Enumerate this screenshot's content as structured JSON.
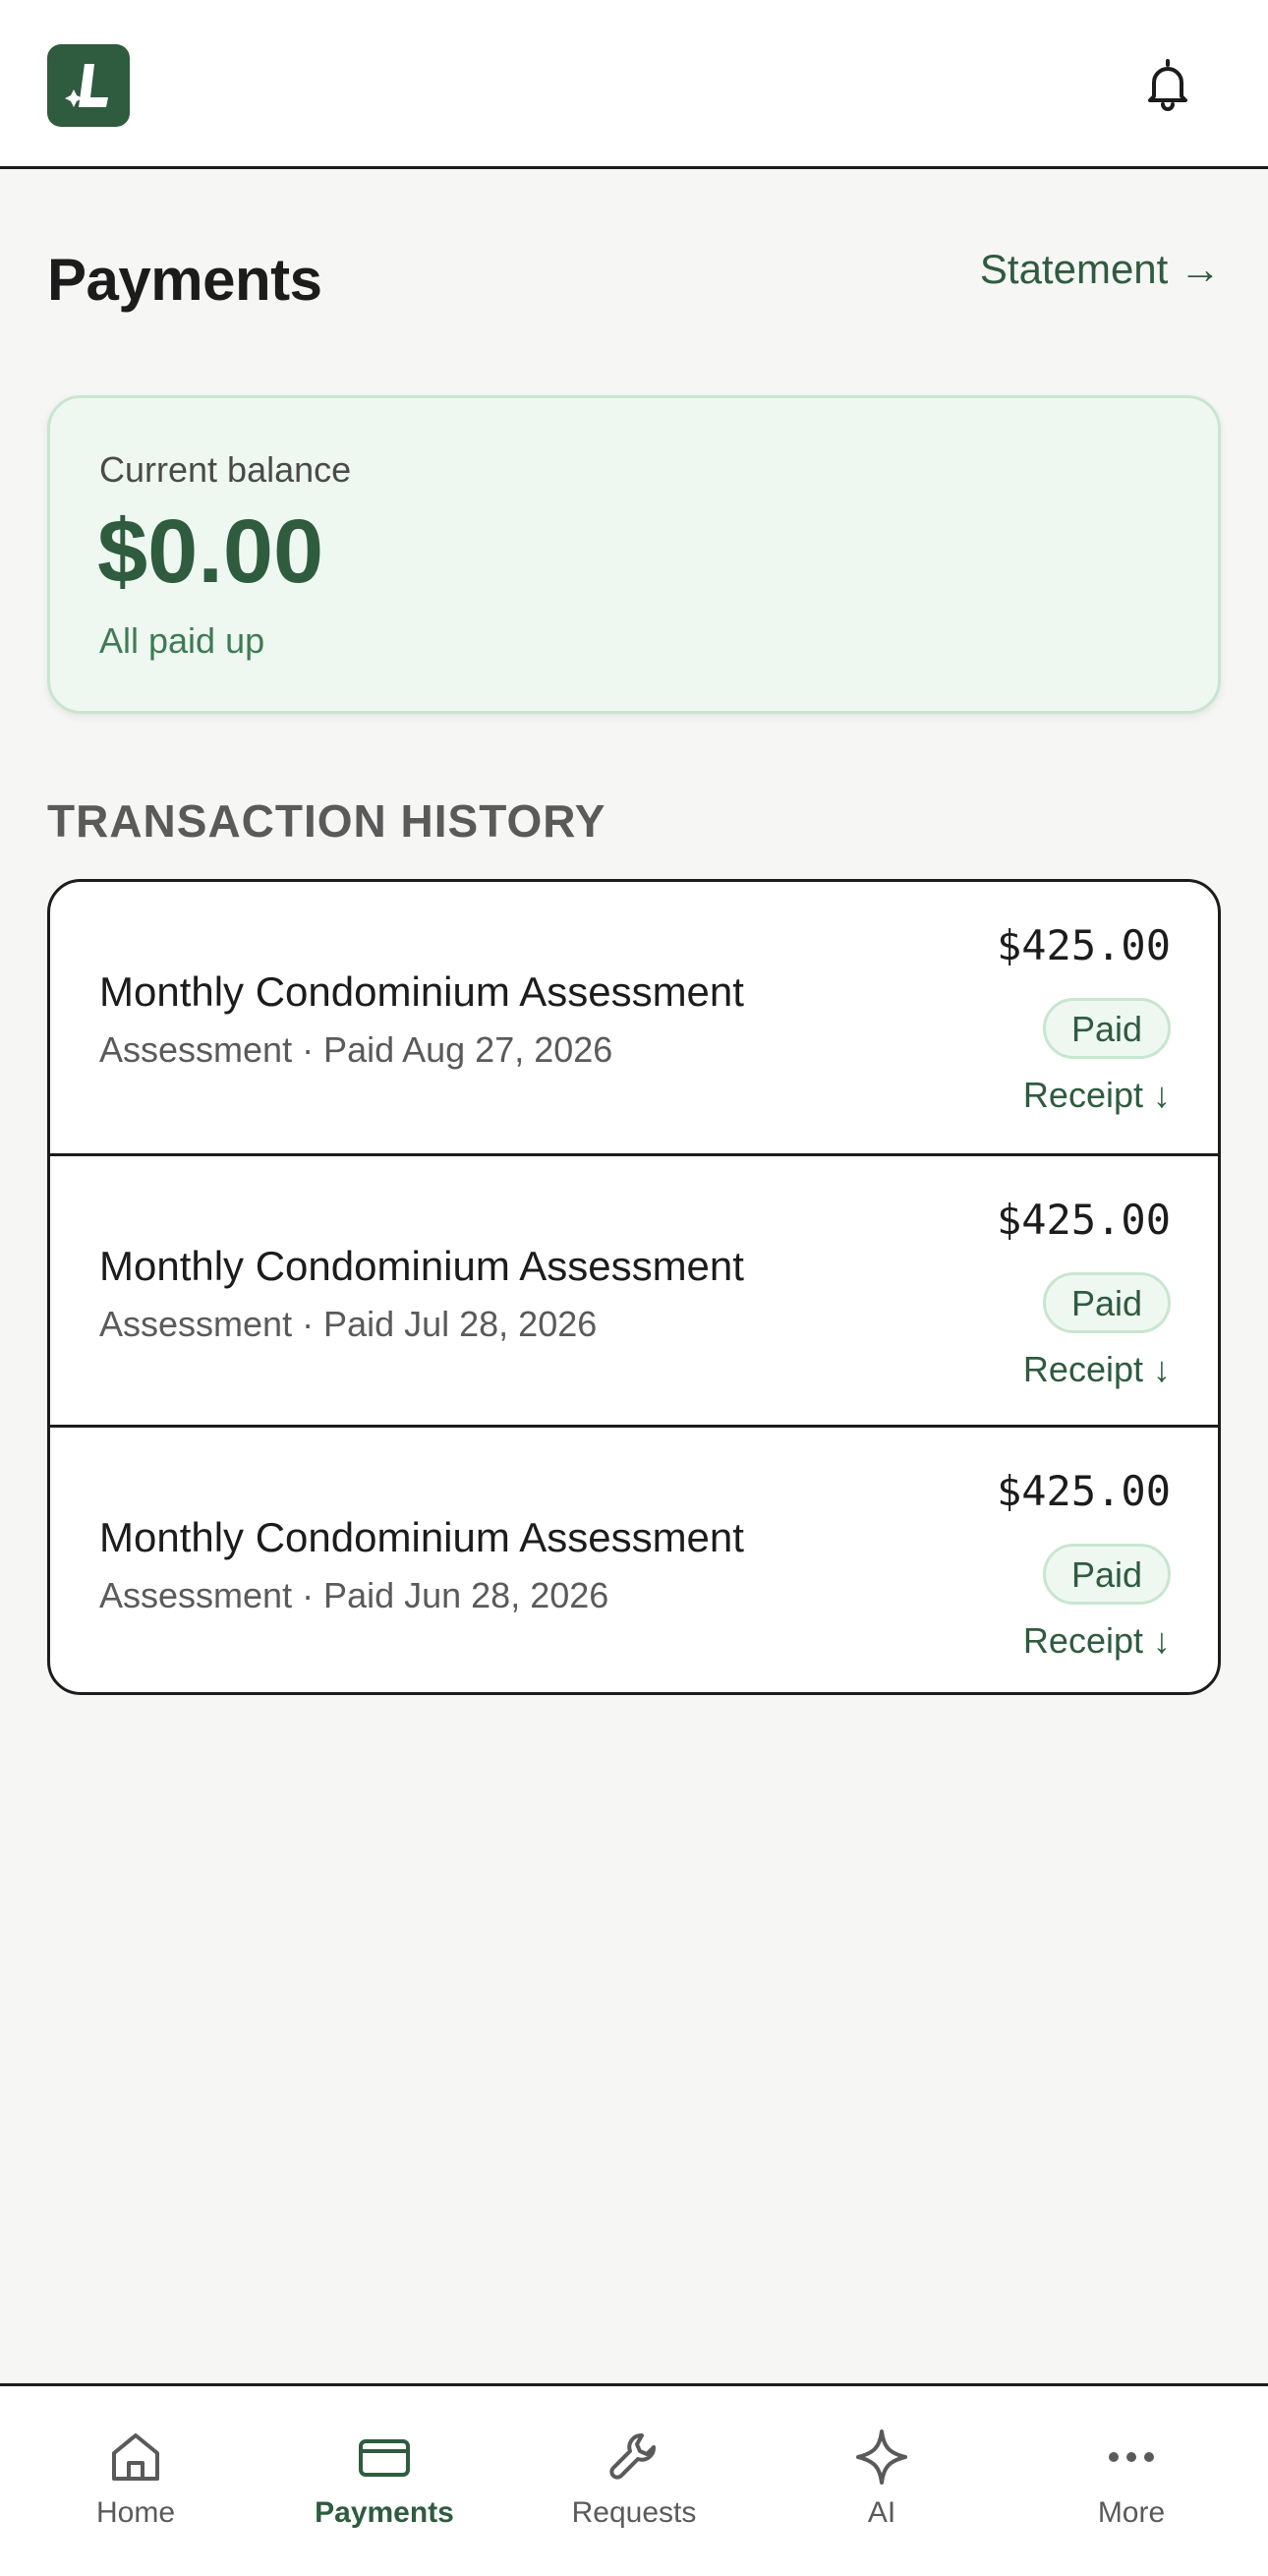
{
  "header": {
    "logo_alt": "App logo",
    "notifications_icon": "bell-icon"
  },
  "page": {
    "title": "Payments",
    "statement_link": "Statement →"
  },
  "balance": {
    "label": "Current balance",
    "amount": "$0.00",
    "status": "All paid up"
  },
  "history": {
    "heading": "TRANSACTION HISTORY",
    "transactions": [
      {
        "title": "Monthly Condominium Assessment",
        "subtitle": "Assessment · Paid Aug 27, 2026",
        "amount": "$425.00",
        "status": "Paid",
        "receipt": "Receipt ↓"
      },
      {
        "title": "Monthly Condominium Assessment",
        "subtitle": "Assessment · Paid Jul 28, 2026",
        "amount": "$425.00",
        "status": "Paid",
        "receipt": "Receipt ↓"
      },
      {
        "title": "Monthly Condominium Assessment",
        "subtitle": "Assessment · Paid Jun 28, 2026",
        "amount": "$425.00",
        "status": "Paid",
        "receipt": "Receipt ↓"
      }
    ]
  },
  "nav": {
    "items": [
      {
        "label": "Home",
        "icon": "home-icon",
        "active": false
      },
      {
        "label": "Payments",
        "icon": "card-icon",
        "active": true
      },
      {
        "label": "Requests",
        "icon": "wrench-icon",
        "active": false
      },
      {
        "label": "AI",
        "icon": "sparkle-icon",
        "active": false
      },
      {
        "label": "More",
        "icon": "more-icon",
        "active": false
      }
    ]
  },
  "colors": {
    "brand": "#2f5b3f",
    "background": "#f6f6f4",
    "success_bg": "#eef8f0",
    "success_border": "#c8e6cf"
  }
}
